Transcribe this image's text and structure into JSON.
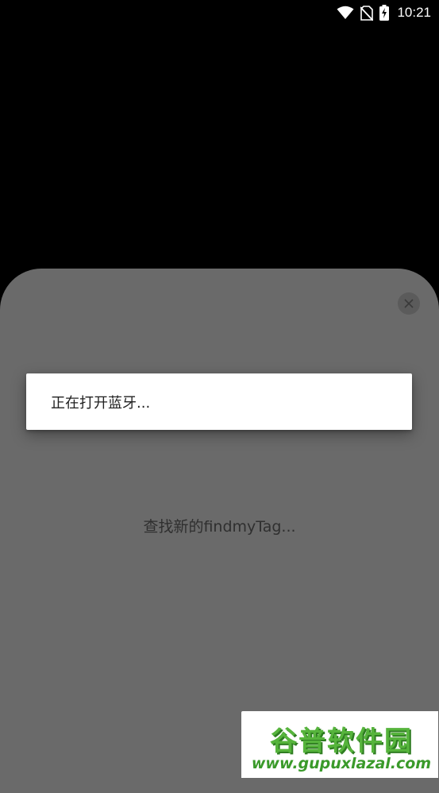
{
  "status_bar": {
    "time": "10:21",
    "icons": [
      "wifi-icon",
      "no-sim-icon",
      "battery-charging-icon"
    ]
  },
  "sheet": {
    "close_icon": "close-icon",
    "searching_text": "查找新的findmyTag..."
  },
  "dialog": {
    "message": "正在打开蓝牙..."
  },
  "watermark": {
    "logo_text": "谷普软件园",
    "url": "www.gupuxlazal.com"
  },
  "colors": {
    "sheet_background": "#6a6a6a",
    "scrim": "#000000",
    "dialog_background": "#ffffff",
    "watermark_green": "#56b43c"
  }
}
